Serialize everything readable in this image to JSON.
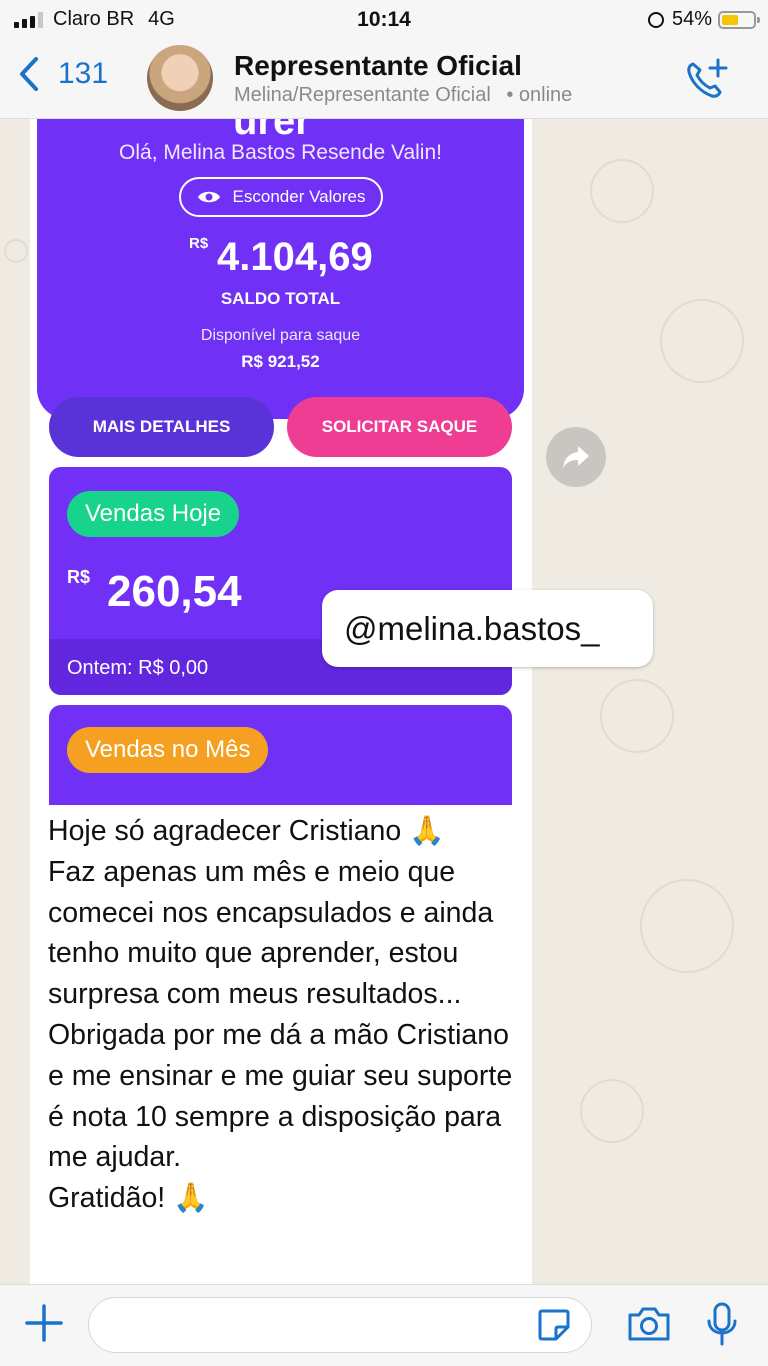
{
  "status_bar": {
    "carrier": "Claro BR",
    "network": "4G",
    "time": "10:14",
    "battery": "54%",
    "battery_level": 0.54
  },
  "header": {
    "back_count": "131",
    "contact_name": "Representante Oficial",
    "contact_subtitle": "Melina/Representante Oficial",
    "status": "• online",
    "icons": {
      "back": "chevron-left-icon",
      "call": "add-call-icon"
    }
  },
  "card": {
    "logo": "urer",
    "greeting": "Olá, Melina Bastos Resende Valin!",
    "hide_values": "Esconder Valores",
    "currency": "R$",
    "total": "4.104,69",
    "total_label": "SALDO TOTAL",
    "available_label": "Disponível para saque",
    "available_value": "R$ 921,52",
    "details_button": "MAIS DETALHES",
    "withdraw_button": "SOLICITAR SAQUE",
    "sales_today_label": "Vendas Hoje",
    "sales_today_value": "260,54",
    "yesterday": "Ontem: R$ 0,00",
    "sales_month_label": "Vendas no Mês"
  },
  "sticker": {
    "handle": "@melina.bastos_"
  },
  "message": {
    "lines": [
      "Hoje só agradecer Cristiano 🙏",
      "Faz apenas um mês e meio que comecei nos encapsulados e ainda tenho muito que aprender, estou surpresa com meus resultados...",
      "Obrigada por me dá a mão Cristiano e me ensinar e me guiar seu suporte é nota 10 sempre a disposição para me ajudar.",
      "Gratidão! 🙏"
    ]
  },
  "colors": {
    "purple": "#7030f5",
    "pink": "#ee3d93",
    "green": "#18d38c",
    "orange": "#f5a020",
    "ios_blue": "#1a73c9"
  }
}
